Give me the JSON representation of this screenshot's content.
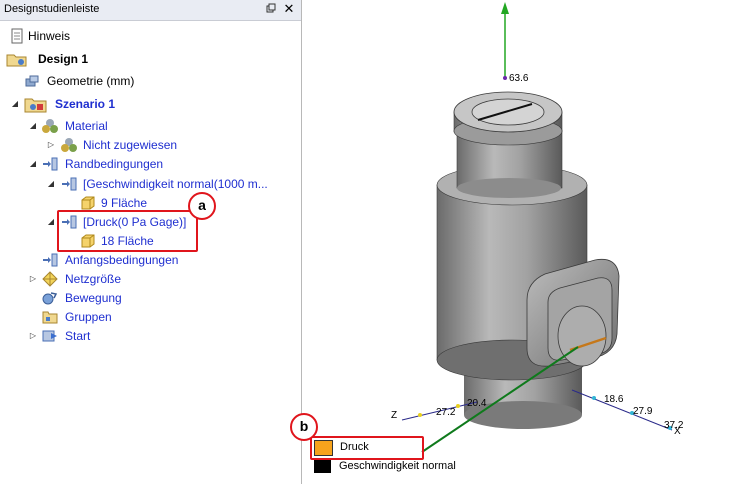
{
  "panel": {
    "title": "Designstudienleiste",
    "pin_icon": "pin-icon",
    "close_label": "✕"
  },
  "tree": {
    "hinweis": "Hinweis",
    "design": "Design 1",
    "geometrie": "Geometrie (mm)",
    "szenario": "Szenario 1",
    "material": "Material",
    "nicht_zugewiesen": "Nicht zugewiesen",
    "randbedingungen": "Randbedingungen",
    "geschwindigkeit": "[Geschwindigkeit normal(1000 m...",
    "flaeche9": "9 Fläche",
    "druck": "[Druck(0 Pa Gage)]",
    "flaeche18": "18 Fläche",
    "anfangsbedingungen": "Anfangsbedingungen",
    "netzgroesse": "Netzgröße",
    "bewegung": "Bewegung",
    "gruppen": "Gruppen",
    "start": "Start"
  },
  "callouts": {
    "a": "a",
    "b": "b"
  },
  "axes": {
    "y_label": "63.6",
    "z_label": "Z",
    "z_tick1": "27.2",
    "z_tick2": "20.4",
    "x_label": "X",
    "x_tick1": "18.6",
    "x_tick2": "27.9",
    "x_tick3": "37.2"
  },
  "legend": {
    "druck_label": "Druck",
    "druck_color": "#f7a31c",
    "geschwindigkeit_label": "Geschwindigkeit normal",
    "geschwindigkeit_color": "#000000"
  },
  "colors": {
    "accent_red": "#e0151c",
    "tree_blue": "#1f2fd0"
  }
}
